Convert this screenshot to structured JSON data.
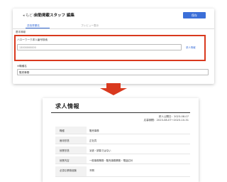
{
  "top": {
    "back": "◂ もどる",
    "title": "自動掲載スタッフ 編集",
    "save_button": "保存",
    "tab1": "送信書類名",
    "tab2": "プレビュー表示",
    "section_label": "基本情報",
    "field_label": "ハローワーク求人番号検索",
    "input_placeholder": "13000000000",
    "link": "求人情報",
    "lower_label": "※職種名",
    "lower_value": "販売事務"
  },
  "doc": {
    "title": "求人情報",
    "date1": "求人公開日：2023-08-07",
    "date2": "応募期間：2023-08-07〜2023-10-31",
    "rows": [
      {
        "label": "職種",
        "value": "販売事務"
      },
      {
        "label": "雇用形態",
        "value": "正社員"
      },
      {
        "label": "就業形態",
        "value": "派遣・請負ではない"
      },
      {
        "label": "就業内容",
        "value": "一般事務業務・販売事務業務・電話応対"
      },
      {
        "label": "必須な業務経験",
        "value": "不問"
      }
    ]
  },
  "colors": {
    "accent": "#d9391e",
    "primary": "#3b6fd8"
  }
}
